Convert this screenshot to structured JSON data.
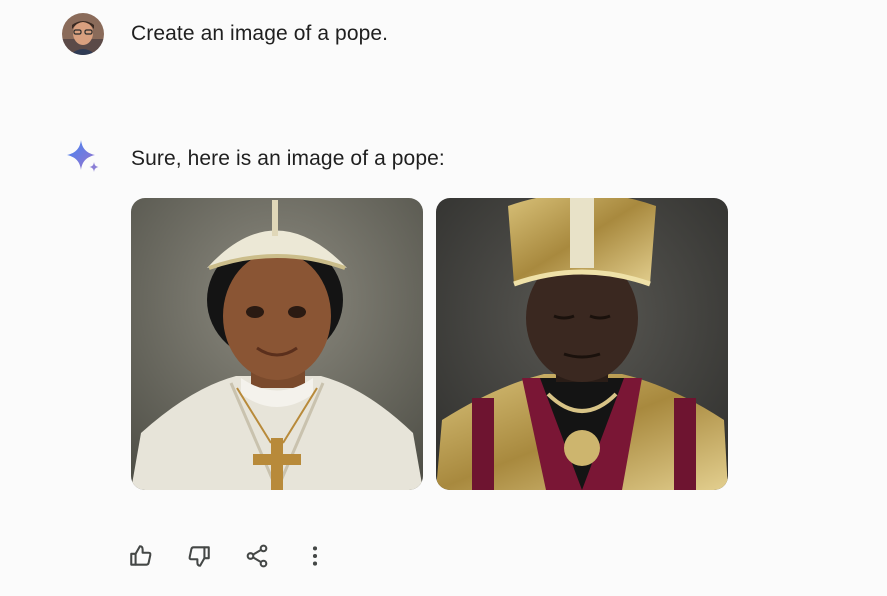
{
  "conversation": {
    "user_prompt": "Create an image of a pope.",
    "assistant_reply": "Sure, here is an image of a pope:"
  },
  "images": [
    {
      "alt": "pope-portrait-1",
      "icon": "image-thumbnail"
    },
    {
      "alt": "pope-portrait-2",
      "icon": "image-thumbnail"
    }
  ],
  "actions": {
    "icons": [
      "thumb-up-icon",
      "thumb-down-icon",
      "share-icon",
      "more-vert-icon"
    ]
  },
  "colors": {
    "text": "#1f1f1f",
    "background": "#fbfbfb",
    "spark_blue": "#4285f4",
    "spark_purple": "#9b72cb",
    "icon_gray": "#444746"
  }
}
